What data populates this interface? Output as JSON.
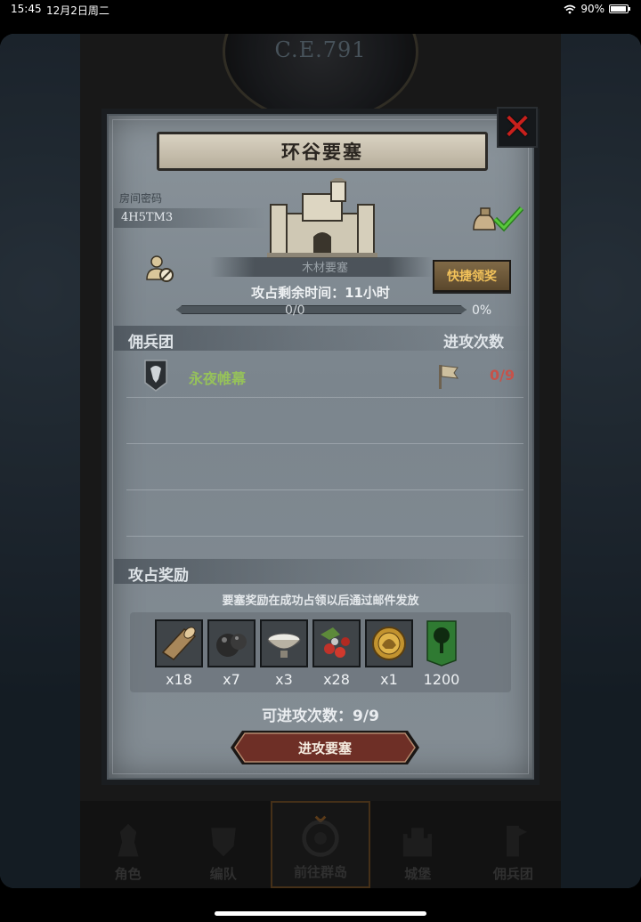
{
  "status_bar": {
    "time": "15:45",
    "date": "12月2日周二",
    "battery": "90%"
  },
  "era": "C.E.791",
  "bottom_nav": [
    {
      "label": "角色"
    },
    {
      "label": "编队"
    },
    {
      "label": "前往群岛"
    },
    {
      "label": "城堡"
    },
    {
      "label": "佣兵团"
    }
  ],
  "modal": {
    "title": "环谷要塞",
    "room_label": "房间密码",
    "room_code": "4H5TM3",
    "fortress_name": "木材要塞",
    "quick_claim": "快捷领奖",
    "time_left": "攻占剩余时间：11小时",
    "progress": {
      "text": "0/0",
      "percent_text": "0%",
      "value": 0
    },
    "mercenary_header": "佣兵团",
    "attacks_header": "进攻次数",
    "guild": {
      "name": "永夜帷幕",
      "attacks": "0/9"
    },
    "reward_header": "攻占奖励",
    "reward_note": "要塞奖励在成功占领以后通过邮件发放",
    "rewards": [
      {
        "icon": "wood-log-icon",
        "qty": "x18"
      },
      {
        "icon": "truffle-icon",
        "qty": "x7"
      },
      {
        "icon": "flour-bowl-icon",
        "qty": "x3"
      },
      {
        "icon": "berries-icon",
        "qty": "x28"
      },
      {
        "icon": "gold-helmet-coin-icon",
        "qty": "x1"
      },
      {
        "icon": "tree-banner-icon",
        "qty": "1200"
      }
    ],
    "attempts": "可进攻次数：9/9",
    "attack_button": "进攻要塞"
  },
  "colors": {
    "close_red": "#c8201c",
    "guild_green": "#96c25a",
    "attacks_red": "#c5524a",
    "claim_gold": "#f2c25a",
    "attack_btn": "#6e2f26"
  }
}
